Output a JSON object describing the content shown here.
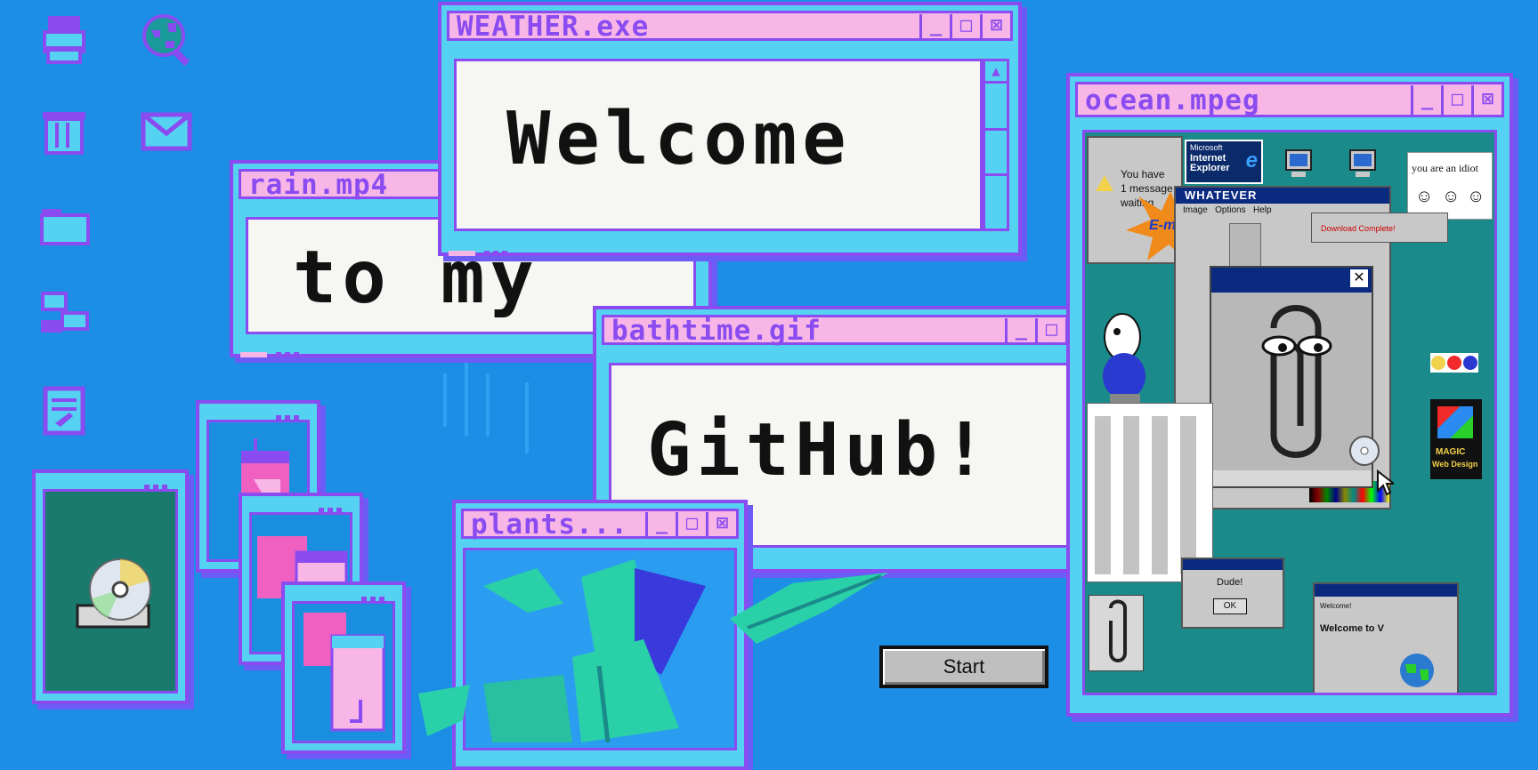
{
  "windows": {
    "weather": {
      "title": "WEATHER.exe",
      "text": "Welcome"
    },
    "rain": {
      "title": "rain.mp4",
      "text": "to my"
    },
    "bathtime": {
      "title": "bathtime.gif",
      "text": "GitHub!"
    },
    "plants": {
      "title": "plants..."
    },
    "ocean": {
      "title": "ocean.mpeg",
      "collage": {
        "you_have": "You have",
        "one_message": "1 message",
        "waiting": "waiting",
        "email_burst": "E-mail",
        "ie_microsoft": "Microsoft",
        "ie_brand": "Internet Explorer",
        "idiot_text": "you are an idiot",
        "whatever_title": "WHATEVER",
        "menu": [
          "Image",
          "Options",
          "Help"
        ],
        "download_text": "Download Complete!",
        "dude_text": "Dude!",
        "ok_text": "OK",
        "magic_title": "MAGIC",
        "magic_sub": "Web Design",
        "welcome_partial": "Welcome to V",
        "welcome_dialog_title": "Welcome!"
      }
    }
  },
  "control_labels": {
    "minimize": "_",
    "maximize": "□",
    "close": "⊠"
  },
  "start_button": {
    "label": "Start"
  },
  "desktop_icons": [
    "printer-icon",
    "globe-search-icon",
    "trash-icon",
    "mail-icon",
    "folder-icon",
    "network-icon",
    "notepad-icon"
  ],
  "colors": {
    "background": "#1c8ee6",
    "window_body": "#55d2f2",
    "titlebar": "#f7b6e6",
    "border": "#8a4bf0",
    "content": "#f6f6f2",
    "collage_teal": "#1a8a8a"
  }
}
